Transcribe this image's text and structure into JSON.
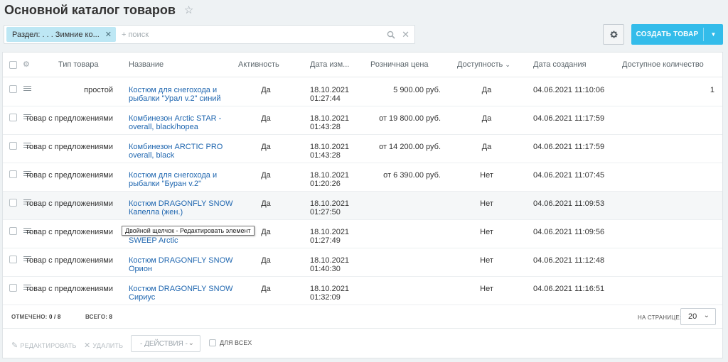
{
  "page": {
    "title": "Основной каталог товаров"
  },
  "filter": {
    "chip_label": "Раздел: . . . Зимние ко...",
    "placeholder": "+ поиск"
  },
  "toolbar": {
    "create_label": "СОЗДАТЬ ТОВАР"
  },
  "table": {
    "headers": {
      "type": "Тип товара",
      "name": "Название",
      "active": "Активность",
      "modified": "Дата изм...",
      "price": "Розничная цена",
      "availability": "Доступность",
      "created": "Дата создания",
      "quantity": "Доступное количество"
    },
    "rows": [
      {
        "type": "простой",
        "name1": "Костюм для снегохода и",
        "name2": "рыбалки \"Урал v.2\" синий",
        "active": "Да",
        "mod1": "18.10.2021",
        "mod2": "01:27:44",
        "price": "5 900.00 руб.",
        "avail": "Да",
        "created": "04.06.2021 11:10:06",
        "qty": "1"
      },
      {
        "type": "товар с предложениями",
        "name1": "Комбинезон Arctic STAR -",
        "name2": "overall, black/hopea",
        "active": "Да",
        "mod1": "18.10.2021",
        "mod2": "01:43:28",
        "price": "от 19 800.00 руб.",
        "avail": "Да",
        "created": "04.06.2021 11:17:59",
        "qty": ""
      },
      {
        "type": "товар с предложениями",
        "name1": "Комбинезон ARCTIC PRO",
        "name2": "overall, black",
        "active": "Да",
        "mod1": "18.10.2021",
        "mod2": "01:43:28",
        "price": "от 14 200.00 руб.",
        "avail": "Да",
        "created": "04.06.2021 11:17:59",
        "qty": ""
      },
      {
        "type": "товар с предложениями",
        "name1": "Костюм для снегохода и",
        "name2": "рыбалки \"Буран v.2\"",
        "active": "Да",
        "mod1": "18.10.2021",
        "mod2": "01:20:26",
        "price": "от 6 390.00 руб.",
        "avail": "Нет",
        "created": "04.06.2021 11:07:45",
        "qty": ""
      },
      {
        "type": "товар с предложениями",
        "name1": "Костюм DRAGONFLY SNOW",
        "name2": "Капелла (жен.)",
        "active": "Да",
        "mod1": "18.10.2021",
        "mod2": "01:27:50",
        "price": "",
        "avail": "Нет",
        "created": "04.06.2021 11:09:53",
        "qty": ""
      },
      {
        "type": "товар с предложениями",
        "name1": "",
        "name2": "SWEEP Arctic",
        "active": "Да",
        "mod1": "18.10.2021",
        "mod2": "01:27:49",
        "price": "",
        "avail": "Нет",
        "created": "04.06.2021 11:09:56",
        "qty": ""
      },
      {
        "type": "товар с предложениями",
        "name1": "Костюм DRAGONFLY SNOW",
        "name2": "Орион",
        "active": "Да",
        "mod1": "18.10.2021",
        "mod2": "01:40:30",
        "price": "",
        "avail": "Нет",
        "created": "04.06.2021 11:12:48",
        "qty": ""
      },
      {
        "type": "товар с предложениями",
        "name1": "Костюм DRAGONFLY SNOW",
        "name2": "Сириус",
        "active": "Да",
        "mod1": "18.10.2021",
        "mod2": "01:32:09",
        "price": "",
        "avail": "Нет",
        "created": "04.06.2021 11:16:51",
        "qty": ""
      }
    ]
  },
  "footer": {
    "selected_label": "ОТМЕЧЕНО:",
    "selected_value": "0 / 8",
    "total_label": "ВСЕГО:",
    "total_value": "8",
    "per_page_label": "НА СТРАНИЦЕ:",
    "per_page_value": "20"
  },
  "actions": {
    "edit": "РЕДАКТИРОВАТЬ",
    "delete": "УДАЛИТЬ",
    "actions_select": "- ДЕЙСТВИЯ -",
    "for_all": "ДЛЯ ВСЕХ"
  },
  "tooltip": "Двойной щелчок - Редактировать элемент",
  "colors": {
    "accent": "#33bcea",
    "link": "#2067b0",
    "chip": "#bde7f4"
  }
}
